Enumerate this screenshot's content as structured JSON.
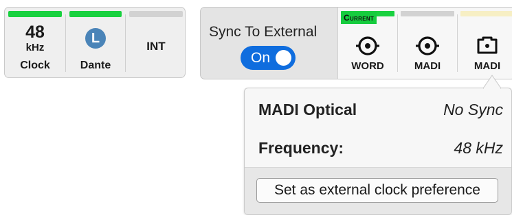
{
  "clock": {
    "rate_value": "48",
    "rate_unit": "kHz",
    "rate_label": "Clock",
    "dante_badge": "L",
    "dante_label": "Dante",
    "int_label": "INT",
    "status_colors": {
      "active": "#19d13f",
      "inactive": "#d2d2d2"
    }
  },
  "sync": {
    "title": "Sync To External",
    "toggle_label": "On",
    "toggle_state": true,
    "accent_color": "#0f6dde",
    "sources": [
      {
        "label": "WORD",
        "icon": "bnc-connector-icon",
        "badge": "Current",
        "status_color": "#19d13f"
      },
      {
        "label": "MADI",
        "icon": "bnc-connector-icon",
        "status_color": "#d2d2d2"
      },
      {
        "label": "MADI",
        "icon": "optical-connector-icon",
        "status_color": "#f7efc4"
      }
    ]
  },
  "popup": {
    "name": "MADI Optical",
    "status": "No Sync",
    "frequency_label": "Frequency:",
    "frequency_value": "48 kHz",
    "button_label": "Set as external clock preference"
  }
}
